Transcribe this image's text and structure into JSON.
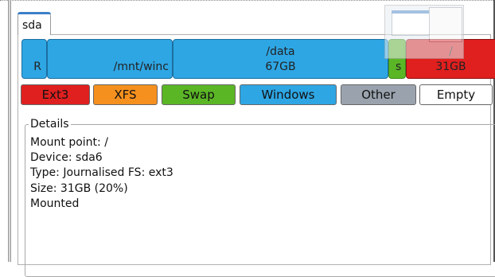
{
  "tab": {
    "label": "sda"
  },
  "partitions": [
    {
      "label": "R"
    },
    {
      "label": "/mnt/winc"
    },
    {
      "label": "/data",
      "size": "67GB"
    },
    {
      "label": "s"
    },
    {
      "label": "/",
      "size": "31GB"
    }
  ],
  "legend": [
    {
      "label": "Ext3",
      "color": "#e01f1f"
    },
    {
      "label": "XFS",
      "color": "#f5901e"
    },
    {
      "label": "Swap",
      "color": "#5bb626"
    },
    {
      "label": "Windows",
      "color": "#2ea6e4"
    },
    {
      "label": "Other",
      "color": "#9aa3ad"
    },
    {
      "label": "Empty",
      "color": "#ffffff"
    }
  ],
  "details": {
    "title": "Details",
    "lines": [
      "Mount point: /",
      "Device: sda6",
      "Type: Journalised FS: ext3",
      "Size: 31GB (20%)",
      "Mounted"
    ]
  }
}
